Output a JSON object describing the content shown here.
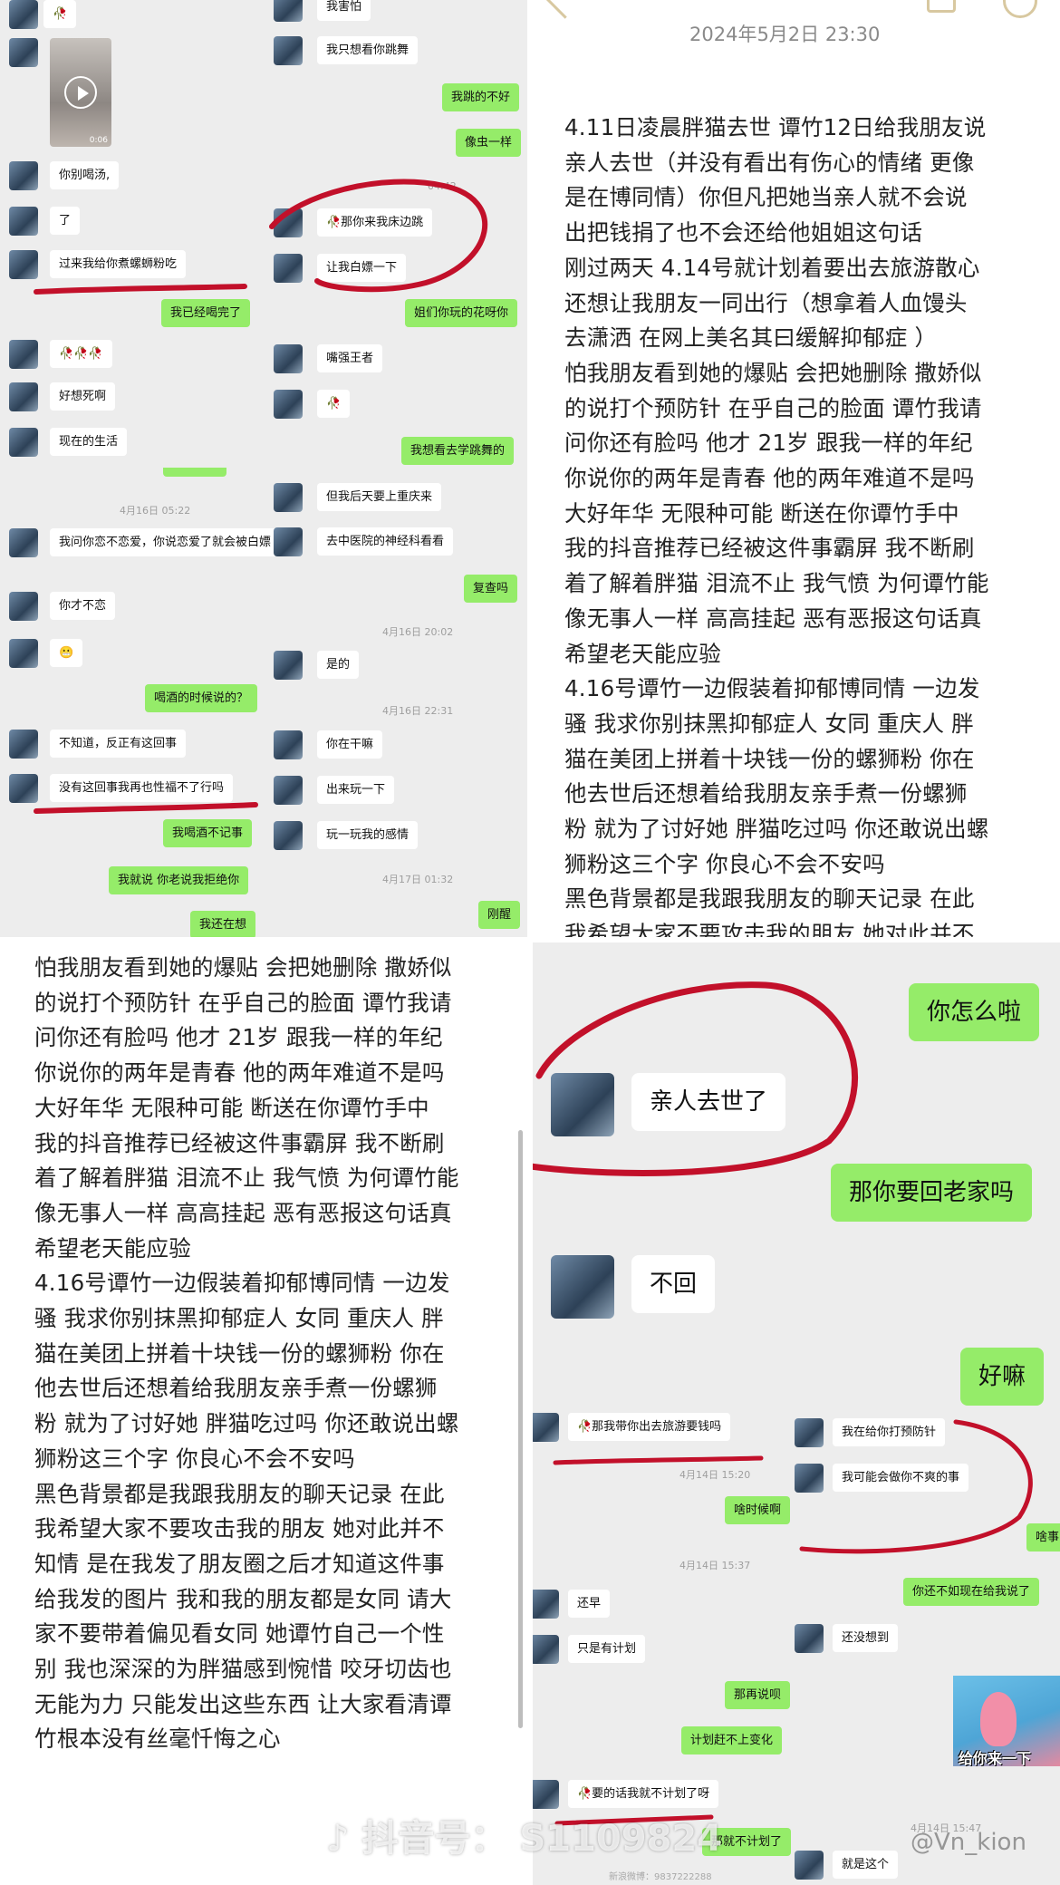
{
  "top_left": {
    "col1": [
      {
        "side": "left",
        "text": "🥀"
      },
      {
        "side": "left",
        "video_duration": "0:06"
      },
      {
        "side": "left",
        "text": "你别喝汤,"
      },
      {
        "side": "left",
        "text": "了"
      },
      {
        "side": "left",
        "text": "过来我给你煮螺蛳粉吃"
      },
      {
        "side": "right",
        "text": "我已经喝完了"
      },
      {
        "side": "left",
        "text": "🥀🥀🥀"
      },
      {
        "side": "left",
        "text": "好想死啊"
      },
      {
        "side": "left",
        "text": "现在的生活"
      },
      {
        "time": "4月16日 05:22"
      },
      {
        "side": "left",
        "text": "我问你恋不恋爱，你说恋爱了就会被白嫖"
      },
      {
        "side": "left",
        "text": "你才不恋"
      },
      {
        "side": "left",
        "text": "😬"
      },
      {
        "side": "right",
        "text": "喝酒的时候说的？"
      },
      {
        "side": "left",
        "text": "不知道，反正有这回事"
      },
      {
        "side": "left",
        "text": "没有这回事我再也性福不了行吗"
      },
      {
        "side": "right",
        "text": "我喝酒不记事"
      },
      {
        "side": "right",
        "text": "我就说 你老说我拒绝你"
      },
      {
        "side": "right",
        "text": "我还在想"
      }
    ],
    "col2": [
      {
        "side": "left",
        "text": "我害怕"
      },
      {
        "side": "left",
        "text": "我只想看你跳舞"
      },
      {
        "side": "right",
        "text": "我跳的不好"
      },
      {
        "side": "right",
        "text": "像虫一样"
      },
      {
        "time": "04:42"
      },
      {
        "side": "left",
        "text": "🥀那你来我床边跳"
      },
      {
        "side": "left",
        "text": "让我白嫖一下"
      },
      {
        "side": "right",
        "text": "姐们你玩的花呀你"
      },
      {
        "side": "left",
        "text": "嘴强王者"
      },
      {
        "side": "left",
        "text": "🥀"
      },
      {
        "side": "right",
        "text": "我想看去学跳舞的"
      },
      {
        "side": "left",
        "text": "但我后天要上重庆来"
      },
      {
        "side": "left",
        "text": "去中医院的神经科看看"
      },
      {
        "side": "right",
        "text": "复查吗"
      },
      {
        "time": "4月16日 20:02"
      },
      {
        "side": "left",
        "text": "是的"
      },
      {
        "time": "4月16日 22:31"
      },
      {
        "side": "left",
        "text": "你在干嘛"
      },
      {
        "side": "left",
        "text": "出来玩一下"
      },
      {
        "side": "left",
        "text": "玩一玩我的感情"
      },
      {
        "time": "4月17日 01:32"
      },
      {
        "side": "right",
        "text": "刚醒"
      }
    ]
  },
  "top_right": {
    "date": "2024年5月2日  23:30",
    "paragraph": "4.11日凌晨胖猫去世 谭竹12日给我朋友说\n亲人去世（并没有看出有伤心的情绪 更像\n是在博同情）你但凡把她当亲人就不会说\n出把钱捐了也不会还给他姐姐这句话\n刚过两天 4.14号就计划着要出去旅游散心\n还想让我朋友一同出行（想拿着人血馒头\n去潇洒 在网上美名其曰缓解抑郁症 ）\n怕我朋友看到她的爆贴 会把她删除 撒娇似\n的说打个预防针 在乎自己的脸面 谭竹我请\n问你还有脸吗 他才 21岁 跟我一样的年纪\n你说你的两年是青春 他的两年难道不是吗\n大好年华 无限种可能 断送在你谭竹手中\n我的抖音推荐已经被这件事霸屏 我不断刷\n着了解着胖猫 泪流不止 我气愤 为何谭竹能\n像无事人一样  高高挂起 恶有恶报这句话真\n希望老天能应验\n4.16号谭竹一边假装着抑郁博同情 一边发\n骚  我求你别抹黑抑郁症人 女同 重庆人 胖\n猫在美团上拼着十块钱一份的螺狮粉 你在\n他去世后还想着给我朋友亲手煮一份螺狮\n粉 就为了讨好她 胖猫吃过吗 你还敢说出螺\n狮粉这三个字 你良心不会不安吗\n黑色背景都是我跟我朋友的聊天记录 在此\n我希望大家不要攻击我的朋友 她对此并不"
  },
  "bottom_left": {
    "paragraph": "怕我朋友看到她的爆贴 会把她删除 撒娇似\n的说打个预防针 在乎自己的脸面 谭竹我请\n问你还有脸吗 他才 21岁 跟我一样的年纪\n你说你的两年是青春 他的两年难道不是吗\n大好年华 无限种可能 断送在你谭竹手中\n我的抖音推荐已经被这件事霸屏 我不断刷\n着了解着胖猫 泪流不止 我气愤 为何谭竹能\n像无事人一样  高高挂起 恶有恶报这句话真\n希望老天能应验\n4.16号谭竹一边假装着抑郁博同情 一边发\n骚  我求你别抹黑抑郁症人 女同 重庆人 胖\n猫在美团上拼着十块钱一份的螺狮粉 你在\n他去世后还想着给我朋友亲手煮一份螺狮\n粉 就为了讨好她 胖猫吃过吗 你还敢说出螺\n狮粉这三个字 你良心不会不安吗\n黑色背景都是我跟我朋友的聊天记录 在此\n我希望大家不要攻击我的朋友 她对此并不\n知情 是在我发了朋友圈之后才知道这件事\n给我发的图片 我和我的朋友都是女同 请大\n家不要带着偏见看女同 她谭竹自己一个性\n别 我也深深的为胖猫感到惋惜 咬牙切齿也\n无能为力 只能发出这些东西 让大家看清谭\n竹根本没有丝毫忏悔之心"
  },
  "bottom_right_top": {
    "messages": [
      {
        "side": "right",
        "text": "你怎么啦"
      },
      {
        "side": "left",
        "text": "亲人去世了"
      },
      {
        "side": "right",
        "text": "那你要回老家吗"
      },
      {
        "side": "left",
        "text": "不回"
      },
      {
        "side": "right",
        "text": "好嘛"
      }
    ]
  },
  "bottom_right_bottom": {
    "col1": [
      {
        "side": "left",
        "text": "🥀那我带你出去旅游要钱吗"
      },
      {
        "time": "4月14日 15:20"
      },
      {
        "side": "right",
        "text": "啥时候啊"
      },
      {
        "time": "4月14日 15:37"
      },
      {
        "side": "left",
        "text": "还早"
      },
      {
        "side": "left",
        "text": "只是有计划"
      },
      {
        "side": "right",
        "text": "那再说呗"
      },
      {
        "side": "right",
        "text": "计划赶不上变化"
      },
      {
        "side": "left",
        "text": "🥀要的话我就不计划了呀"
      },
      {
        "side": "right",
        "text": "那就不计划了"
      }
    ],
    "col2": [
      {
        "side": "left",
        "text": "我在给你打预防针"
      },
      {
        "side": "left",
        "text": "我可能会做你不爽的事"
      },
      {
        "side": "right",
        "text": "啥事"
      },
      {
        "side": "right",
        "text": "你还不如现在给我说了"
      },
      {
        "side": "left",
        "text": "还没想到"
      },
      {
        "sticker_caption": "给你来一下"
      },
      {
        "time": "4月14日 15:47"
      },
      {
        "side": "left",
        "text": "就是这个"
      }
    ]
  },
  "watermarks": {
    "douyin": "抖音号：",
    "douyin_id": "S1109824",
    "weibo": "@Vn_kion",
    "weibo_small": "新浪微博：9837222288"
  },
  "colors": {
    "annotation_red": "#c2102a",
    "wechat_green": "#95ec69",
    "chat_bg": "#ededed"
  }
}
